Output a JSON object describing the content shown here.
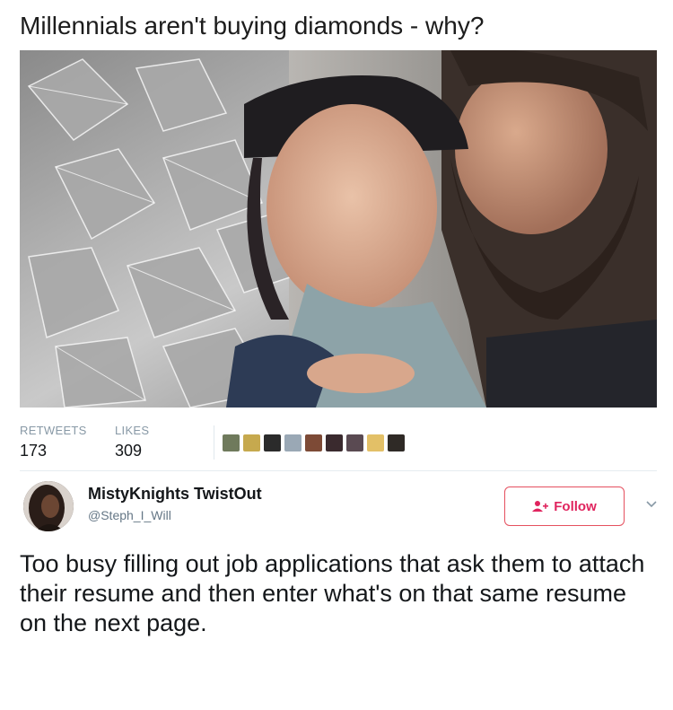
{
  "headline": "Millennials aren't buying diamonds - why?",
  "photo": {
    "icon": "photo-image"
  },
  "stats": {
    "retweets_label": "RETWEETS",
    "retweets_count": "173",
    "likes_label": "LIKES",
    "likes_count": "309"
  },
  "likers": [
    {
      "icon": "liker-avatar-1",
      "color": "#6f7a5c"
    },
    {
      "icon": "liker-avatar-2",
      "color": "#c6a94e"
    },
    {
      "icon": "liker-avatar-3",
      "color": "#2b2b2b"
    },
    {
      "icon": "liker-avatar-4",
      "color": "#9aa8b5"
    },
    {
      "icon": "liker-avatar-5",
      "color": "#7d4a36"
    },
    {
      "icon": "liker-avatar-6",
      "color": "#3a2a2e"
    },
    {
      "icon": "liker-avatar-7",
      "color": "#5a4a52"
    },
    {
      "icon": "liker-avatar-8",
      "color": "#e3c067"
    },
    {
      "icon": "liker-avatar-9",
      "color": "#2f2a26"
    }
  ],
  "tweet": {
    "display_name": "MistyKnights TwistOut",
    "handle": "@Steph_I_Will",
    "follow_label": "Follow",
    "text": "Too busy filling out job applications that ask them to attach their resume and then enter what's on that same resume on the next page.",
    "accent_color": "#e0245e"
  }
}
